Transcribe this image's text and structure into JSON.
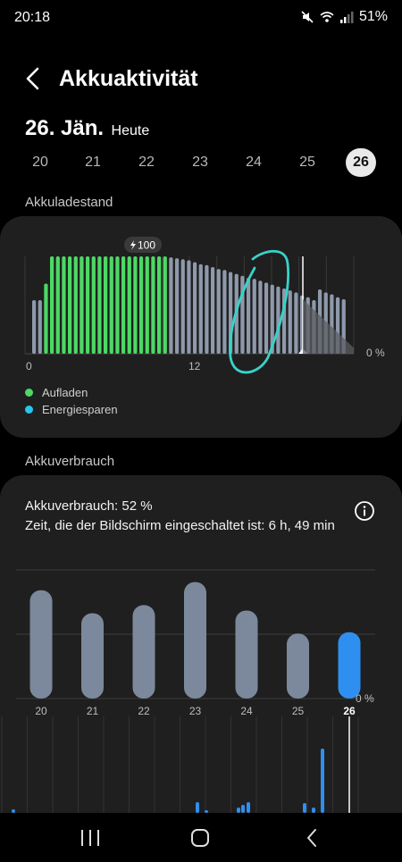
{
  "status_bar": {
    "time": "20:18",
    "battery": "51%",
    "icons": [
      "mute-icon",
      "wifi-icon",
      "signal-icon"
    ]
  },
  "app_bar": {
    "back_icon": "back-chevron-icon",
    "title": "Akkuaktivität"
  },
  "date_header": {
    "date": "26. Jän.",
    "sub": "Heute"
  },
  "day_selector": {
    "days": [
      "20",
      "21",
      "22",
      "23",
      "24",
      "25",
      "26"
    ],
    "selected": "26"
  },
  "battery_level": {
    "section_title": "Akkuladestand",
    "peak_label": "100",
    "x_tick_labels": [
      "0",
      "12"
    ],
    "y_label": "0 %",
    "legend": [
      {
        "label": "Aufladen",
        "color": "#4cd964"
      },
      {
        "label": "Energiesparen",
        "color": "#27c5f0"
      }
    ]
  },
  "battery_usage": {
    "section_title": "Akkuverbrauch",
    "usage_line": "Akkuverbrauch: 52 %",
    "screen_on_line": "Zeit, die der Bildschirm eingeschaltet ist: 6 h, 49 min",
    "y_label": "0 %",
    "info_icon": "info-icon"
  },
  "colors": {
    "charging": "#4cd964",
    "battery_bar": "#8e99ab",
    "daily_bar": "#7c899c",
    "today_bar": "#2e8ff0",
    "card_bg": "#1f1f1f"
  },
  "chart_data": [
    {
      "type": "bar",
      "title": "Akkuladestand",
      "x_ticks": [
        "0",
        "12"
      ],
      "ylabel": "0 %",
      "ylim": [
        0,
        100
      ],
      "hour_step": 0.5,
      "values": [
        55,
        55,
        72,
        100,
        100,
        100,
        100,
        100,
        100,
        100,
        100,
        100,
        100,
        100,
        100,
        100,
        100,
        100,
        100,
        100,
        100,
        100,
        100,
        99,
        98,
        97,
        96,
        94,
        92,
        91,
        89,
        87,
        86,
        84,
        82,
        80,
        78,
        77,
        75,
        73,
        71,
        69,
        67,
        65,
        63,
        60,
        58,
        55,
        66,
        63,
        61,
        58,
        56
      ],
      "charging": [
        false,
        false,
        true,
        true,
        true,
        true,
        true,
        true,
        true,
        true,
        true,
        true,
        true,
        true,
        true,
        true,
        true,
        true,
        true,
        true,
        true,
        true,
        true,
        false,
        false,
        false,
        false,
        false,
        false,
        false,
        false,
        false,
        false,
        false,
        false,
        false,
        false,
        false,
        false,
        false,
        false,
        false,
        false,
        false,
        false,
        false,
        false,
        false,
        false,
        false,
        false,
        false,
        false
      ],
      "projection": {
        "from": 56,
        "to": 6
      },
      "peak_marker": 100
    },
    {
      "type": "bar",
      "title": "Akkuverbrauch",
      "categories": [
        "20",
        "21",
        "22",
        "23",
        "24",
        "25",
        "26"
      ],
      "values": [
        80,
        63,
        69,
        86,
        65,
        48,
        49
      ],
      "ylabel": "0 %",
      "ylim": [
        0,
        95
      ],
      "highlight": "26"
    },
    {
      "type": "bar",
      "title": "Hourly usage",
      "values": [
        0,
        0,
        0,
        0,
        0,
        0,
        0,
        0,
        0,
        0,
        0,
        0,
        0,
        0,
        0,
        0,
        0,
        0,
        0,
        0,
        0,
        0,
        0,
        0,
        0,
        0,
        0,
        0,
        0,
        0,
        0,
        0,
        0,
        0,
        0,
        0,
        0,
        0,
        0,
        0,
        0,
        0,
        0,
        0,
        0,
        0,
        0,
        0,
        0,
        0,
        0,
        0,
        0,
        0,
        0,
        0,
        0,
        0,
        0,
        0,
        0,
        0,
        0,
        0,
        0,
        0,
        0,
        0,
        0,
        0,
        0,
        0,
        0,
        0,
        0,
        0,
        0,
        0,
        0,
        0,
        0,
        0,
        0,
        0,
        0,
        0,
        0,
        0,
        0,
        0,
        0,
        0,
        0,
        0,
        0,
        0,
        0,
        0,
        0,
        0,
        0,
        0,
        0,
        0,
        0,
        0,
        0,
        0,
        0,
        0,
        0,
        0,
        0,
        0,
        0,
        0,
        0,
        0,
        0,
        0,
        0,
        0,
        0,
        0,
        0,
        0,
        0,
        0,
        0,
        0,
        0,
        0,
        0,
        0,
        0,
        0,
        0,
        0,
        0,
        0,
        0,
        0,
        0,
        0,
        0,
        0,
        0,
        0,
        0,
        0,
        0,
        0,
        0,
        0,
        0,
        0,
        0,
        0,
        0,
        0,
        0,
        0,
        0,
        0,
        0,
        0,
        0,
        0
      ]
    }
  ],
  "nav_bar": {
    "icons": [
      "recents-icon",
      "home-icon",
      "back-icon"
    ]
  }
}
